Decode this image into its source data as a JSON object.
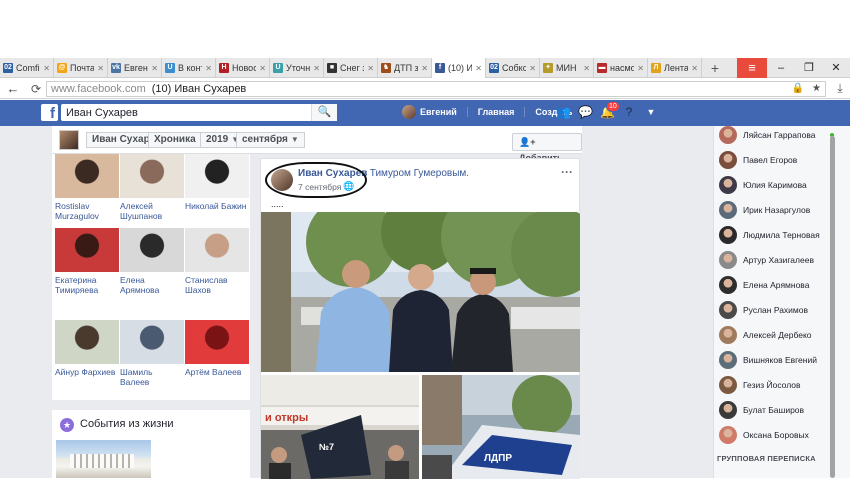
{
  "browser": {
    "tabs": [
      {
        "label": "Comfi",
        "icon": "02",
        "color": "#2d5fa3"
      },
      {
        "label": "Почта",
        "icon": "@",
        "color": "#f2a516"
      },
      {
        "label": "Евген",
        "icon": "vk",
        "color": "#4c75a3"
      },
      {
        "label": "В конт",
        "icon": "U",
        "color": "#3b8fd1"
      },
      {
        "label": "Новос",
        "icon": "H",
        "color": "#b51f24"
      },
      {
        "label": "Уточн",
        "icon": "U",
        "color": "#3ba0a8"
      },
      {
        "label": "Снег з",
        "icon": "■",
        "color": "#333333"
      },
      {
        "label": "ДТП з",
        "icon": "♞",
        "color": "#a04d1c"
      },
      {
        "label": "(10) И",
        "icon": "f",
        "color": "#3b5998",
        "active": true
      },
      {
        "label": "Собкс",
        "icon": "02",
        "color": "#2d5fa3"
      },
      {
        "label": "МИН",
        "icon": "✦",
        "color": "#b59a2c"
      },
      {
        "label": "насмо",
        "icon": "▬",
        "color": "#b82b2b"
      },
      {
        "label": "Лента",
        "icon": "Л",
        "color": "#e0a319"
      }
    ],
    "new_tab": "+",
    "menu": "≡",
    "minimize": "–",
    "maximize": "❐",
    "close": "✕",
    "url_host": "www.facebook.com",
    "url_title": "(10) Иван Сухарев"
  },
  "fb": {
    "logo": "f",
    "search_value": "Иван Сухарев",
    "user": "Евгений",
    "nav_home": "Главная",
    "nav_create": "Создать",
    "notif_count": "10"
  },
  "timeline": {
    "name": "Иван Сухарев",
    "section": "Хроника",
    "year": "2019",
    "month": "сентября",
    "add": "Добавить"
  },
  "friends": [
    {
      "name": "Rostislav Murzagulov",
      "c1": "#d9b99e",
      "c2": "#3b2a22"
    },
    {
      "name": "Алексей Шушпанов",
      "c1": "#e7e1d8",
      "c2": "#8a6a5a"
    },
    {
      "name": "Николай Бажин",
      "c1": "#f0f0f0",
      "c2": "#222222"
    },
    {
      "name": "Екатерина Тимиряева",
      "c1": "#c83a3a",
      "c2": "#3a1a14"
    },
    {
      "name": "Елена Арямнова",
      "c1": "#d8d8d8",
      "c2": "#2a2a2a"
    },
    {
      "name": "Станислав Шахов",
      "c1": "#e5e5e5",
      "c2": "#c79f86"
    },
    {
      "name": "Айнур Фархиев",
      "c1": "#cfd6c6",
      "c2": "#4a3a2e"
    },
    {
      "name": "Шамиль Валеев",
      "c1": "#d7dde4",
      "c2": "#4a5a70"
    },
    {
      "name": "Артём Валеев",
      "c1": "#e23b3b",
      "c2": "#7a1414"
    }
  ],
  "events": {
    "title": "События из жизни"
  },
  "post": {
    "author": "Иван Сухарев",
    "with_text": "с Тимуром Гумеровым.",
    "time": "7 сентября",
    "ellipsis": "....."
  },
  "chat": {
    "contacts": [
      {
        "name": "Ляйсан Гаррапова",
        "color": "#b4695a"
      },
      {
        "name": "Павел Егоров",
        "color": "#7a4d3c"
      },
      {
        "name": "Юлия Каримова",
        "color": "#3f3a4a"
      },
      {
        "name": "Ирик Назаргулов",
        "color": "#5c6b7a"
      },
      {
        "name": "Людмила Терновая",
        "color": "#2a2a2a"
      },
      {
        "name": "Артур Хазигалеев",
        "color": "#8a8a8a"
      },
      {
        "name": "Елена Арямнова",
        "color": "#2e2e2e"
      },
      {
        "name": "Руслан Рахимов",
        "color": "#4a4a4a"
      },
      {
        "name": "Алексей Дербеко",
        "color": "#a07a5c"
      },
      {
        "name": "Вишняков Евгений",
        "color": "#5a6e7a"
      },
      {
        "name": "Гезиз Йосолов",
        "color": "#7a5a40"
      },
      {
        "name": "Булат Баширов",
        "color": "#3a3a3a"
      },
      {
        "name": "Оксана Боровых",
        "color": "#d07a6a"
      }
    ],
    "group_title": "ГРУППОВАЯ ПЕРЕПИСКА"
  }
}
